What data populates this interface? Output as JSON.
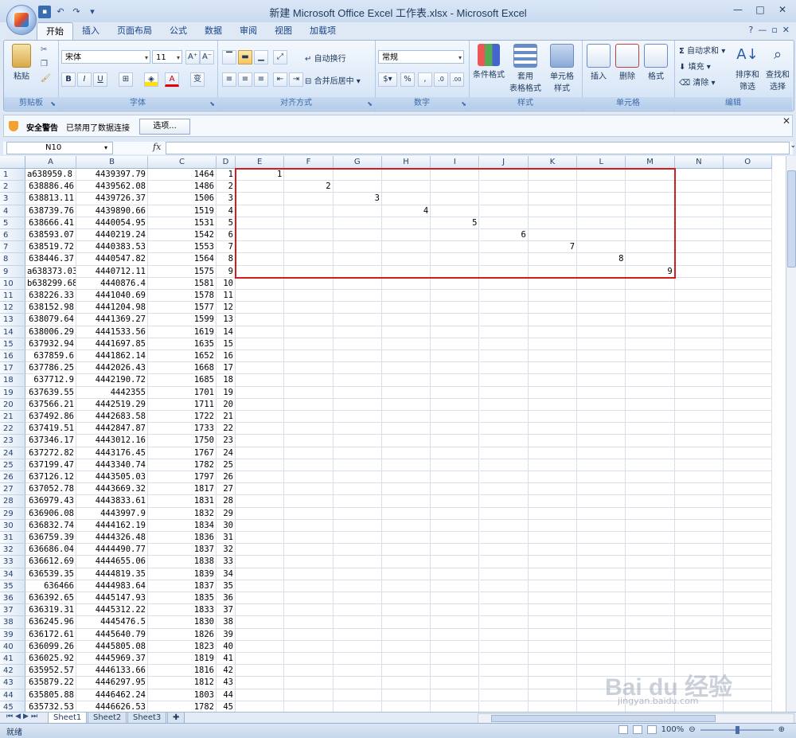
{
  "window": {
    "title": "新建 Microsoft Office Excel 工作表.xlsx - Microsoft Excel",
    "controls": [
      "—",
      "□",
      "✕"
    ]
  },
  "qat": {
    "save": "▪",
    "undo": "↶",
    "redo": "↷",
    "customize": "▾"
  },
  "ribbon_tabs": [
    "开始",
    "插入",
    "页面布局",
    "公式",
    "数据",
    "审阅",
    "视图",
    "加载项"
  ],
  "ribbon_tab_active": "开始",
  "ribbon_right_icons": [
    "?",
    "—",
    "▫",
    "✕"
  ],
  "ribbon": {
    "clipboard": {
      "label": "剪贴板",
      "paste": "粘贴"
    },
    "font": {
      "label": "字体",
      "font_name": "宋体",
      "font_size": "11",
      "grow": "A⁺",
      "shrink": "A⁻",
      "bold": "B",
      "italic": "I",
      "underline": "U",
      "font_color_letter": "A",
      "phonetic": "变"
    },
    "alignment": {
      "label": "对齐方式",
      "wrap": "自动换行",
      "merge": "合并后居中"
    },
    "number": {
      "label": "数字",
      "format": "常规",
      "percent": "%",
      "comma": ",",
      "inc": ".0",
      "dec": ".00"
    },
    "styles": {
      "label": "样式",
      "conditional": "条件格式",
      "as_table_1": "套用",
      "as_table_2": "表格格式",
      "cell_styles_1": "单元格",
      "cell_styles_2": "样式"
    },
    "cells": {
      "label": "单元格",
      "insert": "插入",
      "delete": "删除",
      "format": "格式"
    },
    "editing": {
      "label": "编辑",
      "autosum": "自动求和",
      "fill": "填充",
      "clear": "清除",
      "sort_1": "排序和",
      "sort_2": "筛选",
      "find_1": "查找和",
      "find_2": "选择"
    }
  },
  "security_bar": {
    "title": "安全警告",
    "message": "已禁用了数据连接",
    "options": "选项..."
  },
  "formula_bar": {
    "name_box": "N10",
    "fx": "fx",
    "formula": ""
  },
  "grid": {
    "columns": [
      "A",
      "B",
      "C",
      "D",
      "E",
      "F",
      "G",
      "H",
      "I",
      "J",
      "K",
      "L",
      "M",
      "N",
      "O"
    ],
    "rows": [
      [
        "a638959.8",
        "4439397.79",
        "1464",
        "1"
      ],
      [
        "638886.46",
        "4439562.08",
        "1486",
        "2"
      ],
      [
        "638813.11",
        "4439726.37",
        "1506",
        "3"
      ],
      [
        "638739.76",
        "4439890.66",
        "1519",
        "4"
      ],
      [
        "638666.41",
        "4440054.95",
        "1531",
        "5"
      ],
      [
        "638593.07",
        "4440219.24",
        "1542",
        "6"
      ],
      [
        "638519.72",
        "4440383.53",
        "1553",
        "7"
      ],
      [
        "638446.37",
        "4440547.82",
        "1564",
        "8"
      ],
      [
        "a638373.03",
        "4440712.11",
        "1575",
        "9"
      ],
      [
        "b638299.68",
        "4440876.4",
        "1581",
        "10"
      ],
      [
        "638226.33",
        "4441040.69",
        "1578",
        "11"
      ],
      [
        "638152.98",
        "4441204.98",
        "1577",
        "12"
      ],
      [
        "638079.64",
        "4441369.27",
        "1599",
        "13"
      ],
      [
        "638006.29",
        "4441533.56",
        "1619",
        "14"
      ],
      [
        "637932.94",
        "4441697.85",
        "1635",
        "15"
      ],
      [
        "637859.6",
        "4441862.14",
        "1652",
        "16"
      ],
      [
        "637786.25",
        "4442026.43",
        "1668",
        "17"
      ],
      [
        "637712.9",
        "4442190.72",
        "1685",
        "18"
      ],
      [
        "637639.55",
        "4442355",
        "1701",
        "19"
      ],
      [
        "637566.21",
        "4442519.29",
        "1711",
        "20"
      ],
      [
        "637492.86",
        "4442683.58",
        "1722",
        "21"
      ],
      [
        "637419.51",
        "4442847.87",
        "1733",
        "22"
      ],
      [
        "637346.17",
        "4443012.16",
        "1750",
        "23"
      ],
      [
        "637272.82",
        "4443176.45",
        "1767",
        "24"
      ],
      [
        "637199.47",
        "4443340.74",
        "1782",
        "25"
      ],
      [
        "637126.12",
        "4443505.03",
        "1797",
        "26"
      ],
      [
        "637052.78",
        "4443669.32",
        "1817",
        "27"
      ],
      [
        "636979.43",
        "4443833.61",
        "1831",
        "28"
      ],
      [
        "636906.08",
        "4443997.9",
        "1832",
        "29"
      ],
      [
        "636832.74",
        "4444162.19",
        "1834",
        "30"
      ],
      [
        "636759.39",
        "4444326.48",
        "1836",
        "31"
      ],
      [
        "636686.04",
        "4444490.77",
        "1837",
        "32"
      ],
      [
        "636612.69",
        "4444655.06",
        "1838",
        "33"
      ],
      [
        "636539.35",
        "4444819.35",
        "1839",
        "34"
      ],
      [
        "636466",
        "4444983.64",
        "1837",
        "35"
      ],
      [
        "636392.65",
        "4445147.93",
        "1835",
        "36"
      ],
      [
        "636319.31",
        "4445312.22",
        "1833",
        "37"
      ],
      [
        "636245.96",
        "4445476.5",
        "1830",
        "38"
      ],
      [
        "636172.61",
        "4445640.79",
        "1826",
        "39"
      ],
      [
        "636099.26",
        "4445805.08",
        "1823",
        "40"
      ],
      [
        "636025.92",
        "4445969.37",
        "1819",
        "41"
      ],
      [
        "635952.57",
        "4446133.66",
        "1816",
        "42"
      ],
      [
        "635879.22",
        "4446297.95",
        "1812",
        "43"
      ],
      [
        "635805.88",
        "4446462.24",
        "1803",
        "44"
      ],
      [
        "635732.53",
        "4446626.53",
        "1782",
        "45"
      ]
    ],
    "diagonal_values": [
      {
        "row": 1,
        "col": "E",
        "value": "1"
      },
      {
        "row": 2,
        "col": "F",
        "value": "2"
      },
      {
        "row": 3,
        "col": "G",
        "value": "3"
      },
      {
        "row": 4,
        "col": "H",
        "value": "4"
      },
      {
        "row": 5,
        "col": "I",
        "value": "5"
      },
      {
        "row": 6,
        "col": "J",
        "value": "6"
      },
      {
        "row": 7,
        "col": "K",
        "value": "7"
      },
      {
        "row": 8,
        "col": "L",
        "value": "8"
      },
      {
        "row": 9,
        "col": "M",
        "value": "9"
      }
    ],
    "highlight_color": "#d01e1e"
  },
  "sheets": [
    "Sheet1",
    "Sheet2",
    "Sheet3"
  ],
  "sheet_active": "Sheet1",
  "status": {
    "mode": "就绪",
    "zoom": "100%",
    "zoom_out": "⊖",
    "zoom_in": "⊕"
  },
  "watermark": {
    "brand": "Bai du 经验",
    "url": "jingyan.baidu.com"
  }
}
